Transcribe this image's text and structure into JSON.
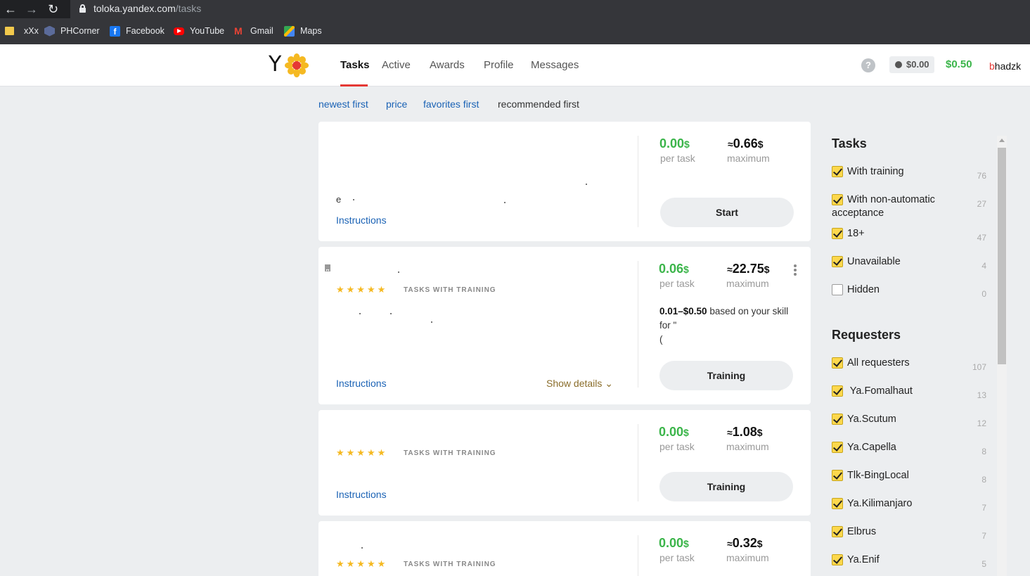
{
  "browser": {
    "url_host": "toloka.yandex.com",
    "url_path": "/tasks",
    "bookmarks": [
      {
        "label": "xXx",
        "icon": "folder-icon"
      },
      {
        "label": "PHCorner",
        "icon": "phcorner-icon"
      },
      {
        "label": "Facebook",
        "icon": "facebook-icon"
      },
      {
        "label": "YouTube",
        "icon": "youtube-icon"
      },
      {
        "label": "Gmail",
        "icon": "gmail-icon"
      },
      {
        "label": "Maps",
        "icon": "maps-icon"
      }
    ]
  },
  "header": {
    "logo_text": "Y",
    "nav": [
      "Tasks",
      "Active",
      "Awards",
      "Profile",
      "Messages"
    ],
    "active_nav": "Tasks",
    "help_label": "?",
    "pending_balance": "$0.00",
    "balance": "$0.50",
    "user_first": "b",
    "user_rest": "hadzk"
  },
  "sort_options": [
    "newest first",
    "price",
    "favorites first",
    "recommended first"
  ],
  "sort_current": "recommended first",
  "cards": [
    {
      "price": "0.00",
      "price_label": "per task",
      "max": "0.66",
      "max_label": "maximum",
      "button": "Start",
      "instructions": "Instructions",
      "text_fragment": "e"
    },
    {
      "price": "0.06",
      "price_label": "per task",
      "max": "22.75",
      "max_label": "maximum",
      "button": "Training",
      "instructions": "Instructions",
      "tag": "TASKS WITH TRAINING",
      "rating": 5,
      "show_details": "Show details",
      "skill_range": "0.01–$0.50",
      "skill_text": " based on your skill",
      "skill_for": "for \"",
      "skill_line3": "("
    },
    {
      "price": "0.00",
      "price_label": "per task",
      "max": "1.08",
      "max_label": "maximum",
      "button": "Training",
      "instructions": "Instructions",
      "tag": "TASKS WITH TRAINING",
      "rating": 5
    },
    {
      "price": "0.00",
      "price_label": "per task",
      "max": "0.32",
      "max_label": "maximum",
      "tag": "TASKS WITH TRAINING",
      "rating": 5
    }
  ],
  "currency": "$",
  "approx": "≈",
  "stars_text": "★★★★★",
  "sidebar": {
    "tasks_title": "Tasks",
    "task_filters": [
      {
        "label": "With training",
        "count": "76",
        "checked": true
      },
      {
        "label": "With non-automatic acceptance",
        "count": "27",
        "checked": true
      },
      {
        "label": "18+",
        "count": "47",
        "checked": true
      },
      {
        "label": "Unavailable",
        "count": "4",
        "checked": true
      },
      {
        "label": "Hidden",
        "count": "0",
        "checked": false
      }
    ],
    "requesters_title": "Requesters",
    "requesters": [
      {
        "label": "All requesters",
        "count": "107",
        "checked": true
      },
      {
        "label": " Ya.Fomalhaut",
        "count": "13",
        "checked": true
      },
      {
        "label": "Ya.Scutum",
        "count": "12",
        "checked": true
      },
      {
        "label": "Ya.Capella",
        "count": "8",
        "checked": true
      },
      {
        "label": "Tlk-BingLocal",
        "count": "8",
        "checked": true
      },
      {
        "label": "Ya.Kilimanjaro",
        "count": "7",
        "checked": true
      },
      {
        "label": "Elbrus",
        "count": "7",
        "checked": true
      },
      {
        "label": "Ya.Enif",
        "count": "5",
        "checked": true
      }
    ]
  },
  "colors": {
    "green": "#3bb54a",
    "link": "#1a62b5",
    "accent": "#e53935",
    "star": "#f5b922",
    "checkbox": "#fdd84d"
  }
}
